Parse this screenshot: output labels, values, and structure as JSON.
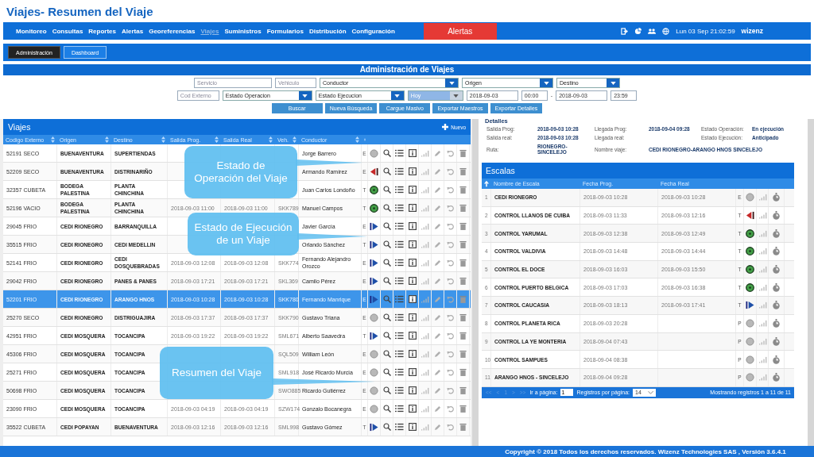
{
  "page_title": "Viajes- Resumen del Viaje",
  "nav": {
    "items": [
      {
        "label": "Monitoreo",
        "selected": false
      },
      {
        "label": "Consultas",
        "selected": false
      },
      {
        "label": "Reportes",
        "selected": false
      },
      {
        "label": "Alertas",
        "selected": false
      },
      {
        "label": "Georeferencias",
        "selected": false
      },
      {
        "label": "Viajes",
        "selected": true
      },
      {
        "label": "Suministros",
        "selected": false
      },
      {
        "label": "Formularios",
        "selected": false
      },
      {
        "label": "Distribución",
        "selected": false
      },
      {
        "label": "Configuración",
        "selected": false
      }
    ],
    "alert_button": "Alertas",
    "datetime": "Lun 03 Sep 21:02:59",
    "user": "wizenz"
  },
  "subtabs": [
    {
      "label": "Administración",
      "selected": true
    },
    {
      "label": "Dashboard",
      "selected": false
    }
  ],
  "admin": {
    "title": "Administración de Viajes",
    "filter_rows": [
      [
        {
          "kind": "input",
          "placeholder": "Servicio"
        },
        {
          "kind": "input",
          "placeholder": "Vehiculo"
        },
        {
          "kind": "select",
          "value": "Conductor"
        },
        {
          "kind": "select",
          "value": "Origen"
        },
        {
          "kind": "select",
          "value": "Destino"
        }
      ],
      [
        {
          "kind": "input",
          "placeholder": "Cod Externo"
        },
        {
          "kind": "select",
          "value": "Estado Operacion"
        },
        {
          "kind": "select",
          "value": "Estado Ejecucion"
        },
        {
          "kind": "quick_select",
          "value": "Hoy"
        },
        {
          "kind": "date",
          "value": "2018-09-03"
        },
        {
          "kind": "time",
          "value": "00:00"
        },
        {
          "kind": "separator",
          "value": "-"
        },
        {
          "kind": "date",
          "value": "2018-09-03"
        },
        {
          "kind": "time",
          "value": "23:59"
        }
      ]
    ],
    "buttons": [
      "Buscar",
      "Nueva Búsqueda",
      "Cargue Masivo",
      "Exportar Maestros",
      "Exportar Detalles"
    ]
  },
  "trips": {
    "title": "Viajes",
    "new_button": "Nuevo",
    "columns": [
      "Codigo Externo",
      "Origen",
      "Destino",
      "Salida Prog.",
      "Salida Real",
      "Veh.",
      "Conductor"
    ],
    "rows": [
      {
        "code": "52191 SECO",
        "origin": "BUENAVENTURA",
        "destination": "SUPERTIENDAS",
        "driver": "Jorge Barrero",
        "mode": "E",
        "kind": "pending",
        "selected": false
      },
      {
        "code": "52209 SECO",
        "origin": "BUENAVENTURA",
        "destination": "DISTRINARIÑO",
        "driver": "Armando Ramírez",
        "mode": "E",
        "kind": "late",
        "selected": false
      },
      {
        "code": "32357 CUBETA",
        "origin": "BODEGA PALESTINA",
        "destination": "PLANTA CHINCHINA",
        "driver": "Juan Carlos Londoño",
        "mode": "T",
        "kind": "on_time",
        "selected": false
      },
      {
        "code": "52196 VACIO",
        "origin": "BODEGA PALESTINA",
        "destination": "PLANTA CHINCHINA",
        "planned": "2018-09-03 11:00",
        "actual": "2018-09-03 11:00",
        "vehicle": "SKK789",
        "driver": "Manuel Campos",
        "mode": "T",
        "kind": "on_time",
        "selected": false
      },
      {
        "code": "29045 FRIO",
        "origin": "CEDI RIONEGRO",
        "destination": "BARRANQUILLA",
        "driver": "Javier García",
        "mode": "E",
        "kind": "running",
        "selected": false
      },
      {
        "code": "35515 FRIO",
        "origin": "CEDI RIONEGRO",
        "destination": "CEDI MEDELLIN",
        "driver": "Orlando Sánchez",
        "mode": "T",
        "kind": "running",
        "selected": false
      },
      {
        "code": "52141 FRIO",
        "origin": "CEDI RIONEGRO",
        "destination": "CEDI DOSQUEBRADAS",
        "planned": "2018-09-03 12:08",
        "actual": "2018-09-03 12:08",
        "vehicle": "SKK774",
        "driver": "Fernando Alejandro Orozco",
        "mode": "E",
        "kind": "running",
        "selected": false
      },
      {
        "code": "29042 FRIO",
        "origin": "CEDI RIONEGRO",
        "destination": "PANES & PANES",
        "planned": "2018-09-03 17:21",
        "actual": "2018-09-03 17:21",
        "vehicle": "SKL369",
        "driver": "Camilo Pérez",
        "mode": "E",
        "kind": "running",
        "selected": false
      },
      {
        "code": "52201 FRIO",
        "origin": "CEDI RIONEGRO",
        "destination": "ARANGO HNOS",
        "planned": "2018-09-03 10:28",
        "actual": "2018-09-03 10:28",
        "vehicle": "SKK780",
        "driver": "Fernando Manrique",
        "mode": "E",
        "kind": "running",
        "selected": true
      },
      {
        "code": "25270 SECO",
        "origin": "CEDI RIONEGRO",
        "destination": "DISTRIGUAJIRA",
        "planned": "2018-09-03 17:37",
        "actual": "2018-09-03 17:37",
        "vehicle": "SKK790",
        "driver": "Gustavo Triana",
        "mode": "E",
        "kind": "pending",
        "selected": false
      },
      {
        "code": "42951 FRIO",
        "origin": "CEDI MOSQUERA",
        "destination": "TOCANCIPA",
        "planned": "2018-09-03 19:22",
        "actual": "2018-09-03 19:22",
        "vehicle": "SML671",
        "driver": "Alberto Saavedra",
        "mode": "T",
        "kind": "running",
        "selected": false
      },
      {
        "code": "45306 FRIO",
        "origin": "CEDI MOSQUERA",
        "destination": "TOCANCIPA",
        "vehicle": "SQL509",
        "driver": "William León",
        "mode": "E",
        "kind": "pending",
        "selected": false
      },
      {
        "code": "25271 FRIO",
        "origin": "CEDI MOSQUERA",
        "destination": "TOCANCIPA",
        "vehicle": "SML918",
        "driver": "José Ricardo Murcia",
        "mode": "E",
        "kind": "pending",
        "selected": false
      },
      {
        "code": "50698 FRIO",
        "origin": "CEDI MOSQUERA",
        "destination": "TOCANCIPA",
        "vehicle": "SWO885",
        "driver": "Ricardo Gutiérrez",
        "mode": "E",
        "kind": "pending",
        "selected": false
      },
      {
        "code": "23090 FRIO",
        "origin": "CEDI MOSQUERA",
        "destination": "TOCANCIPA",
        "planned": "2018-09-03 04:19",
        "actual": "2018-09-03 04:19",
        "vehicle": "SZW174",
        "driver": "Gonzalo Bocanegra",
        "mode": "E",
        "kind": "pending",
        "selected": false
      },
      {
        "code": "35522 CUBETA",
        "origin": "CEDI POPAYAN",
        "destination": "BUENAVENTURA",
        "planned": "2018-09-03 12:16",
        "actual": "2018-09-03 12:16",
        "vehicle": "SML998",
        "driver": "Gustavo Gómez",
        "mode": "T",
        "kind": "running",
        "selected": false
      }
    ]
  },
  "details": {
    "title": "Detalles",
    "fields": [
      {
        "label": "Salida Prog:",
        "value": "2018-09-03 10:28"
      },
      {
        "label": "Llegada Prog:",
        "value": "2018-09-04 09:28"
      },
      {
        "label": "Estado Operación:",
        "value": "En ejecución"
      },
      {
        "label": "Salida real:",
        "value": "2018-09-03 10:28"
      },
      {
        "label": "Llegada real:"
      },
      {
        "label": "Estado Ejecución:",
        "value": "Anticipado"
      },
      {
        "label": "Ruta:",
        "value": "RIONEGRO-SINCELEJO"
      },
      {
        "label": "Nombre viaje:",
        "value": "CEDI RIONEGRO-ARANGO HNOS SINCELEJO"
      }
    ]
  },
  "stops": {
    "title": "Escalas",
    "columns": [
      "Nombre de Escala",
      "Fecha Prog.",
      "Fecha Real"
    ],
    "rows": [
      {
        "number": "1",
        "name": "CEDI RIONEGRO",
        "planned": "2018-09-03 10:28",
        "actual": "2018-09-03 10:28",
        "mode": "E",
        "kind": "pending"
      },
      {
        "number": "2",
        "name": "CONTROL LLANOS DE CUIBA",
        "planned": "2018-09-03 11:33",
        "actual": "2018-09-03 12:16",
        "mode": "T",
        "kind": "late"
      },
      {
        "number": "3",
        "name": "CONTROL YARUMAL",
        "planned": "2018-09-03 12:38",
        "actual": "2018-09-03 12:49",
        "mode": "T",
        "kind": "on_time"
      },
      {
        "number": "4",
        "name": "CONTROL VALDIVIA",
        "planned": "2018-09-03 14:48",
        "actual": "2018-09-03 14:44",
        "mode": "T",
        "kind": "on_time"
      },
      {
        "number": "5",
        "name": "CONTROL EL DOCE",
        "planned": "2018-09-03 16:03",
        "actual": "2018-09-03 15:50",
        "mode": "T",
        "kind": "on_time"
      },
      {
        "number": "6",
        "name": "CONTROL PUERTO BELGICA",
        "planned": "2018-09-03 17:03",
        "actual": "2018-09-03 16:38",
        "mode": "T",
        "kind": "on_time"
      },
      {
        "number": "7",
        "name": "CONTROL CAUCASIA",
        "planned": "2018-09-03 18:13",
        "actual": "2018-09-03 17:41",
        "mode": "T",
        "kind": "running"
      },
      {
        "number": "8",
        "name": "CONTROL PLANETA RICA",
        "planned": "2018-09-03 20:28",
        "mode": "P",
        "kind": "pending"
      },
      {
        "number": "9",
        "name": "CONTROL LA YE MONTERIA",
        "planned": "2018-09-04 07:43",
        "mode": "P",
        "kind": "pending"
      },
      {
        "number": "10",
        "name": "CONTROL SAMPUES",
        "planned": "2018-09-04 08:38",
        "mode": "P",
        "kind": "pending"
      },
      {
        "number": "11",
        "name": "ARANGO HNOS - SINCELEJO",
        "planned": "2018-09-04 09:28",
        "mode": "P",
        "kind": "pending"
      }
    ],
    "pager": {
      "nav": [
        "<<",
        "<",
        "1",
        ">",
        ">>"
      ],
      "goto_label": "Ir a página:",
      "page": "1",
      "per_page_label": "Registros por página:",
      "per_page": "14",
      "summary": "Mostrando registros 1 a 11 de 11"
    }
  },
  "callouts": [
    {
      "text": "Estado de Operación del Viaje"
    },
    {
      "text": "Estado de Ejecución de un Viaje"
    },
    {
      "text": "Resumen del Viaje"
    }
  ],
  "footer": "Copyright © 2018 Todos los derechos reservados. Wizenz Technologies SAS , Versión 3.6.4.1"
}
